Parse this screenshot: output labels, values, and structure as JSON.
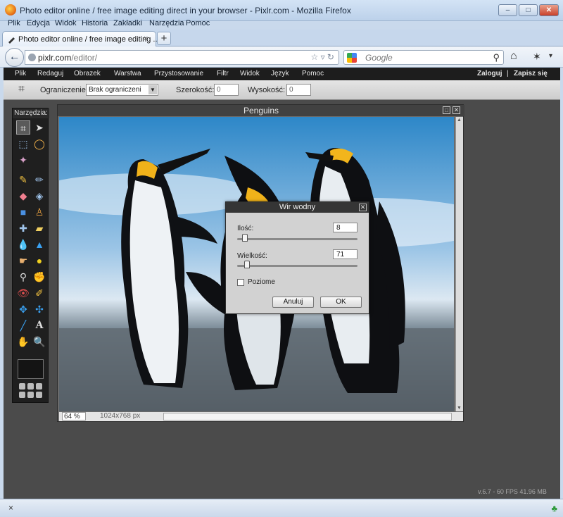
{
  "browser": {
    "window_title": "Photo editor online / free image editing direct in your browser - Pixlr.com - Mozilla Firefox",
    "menu": [
      "Plik",
      "Edycja",
      "Widok",
      "Historia",
      "Zakładki",
      "Narzędzia",
      "Pomoc"
    ],
    "tab_label": "Photo editor online / free image editing ...",
    "tab_close": "×",
    "new_tab": "+",
    "url_host": "pixlr.com",
    "url_path": "/editor/",
    "search_placeholder": "Google",
    "window_buttons": {
      "minimize": "–",
      "maximize": "□",
      "close": "✕"
    },
    "status_close": "×"
  },
  "pixlr": {
    "menu": [
      "Plik",
      "Redaguj",
      "Obrazek",
      "Warstwa",
      "Przystosowanie",
      "Filtr",
      "Widok",
      "Język",
      "Pomoc"
    ],
    "login": "Zaloguj",
    "separator": "|",
    "register": "Zapisz się",
    "crop_bar": {
      "constraint_label": "Ograniczenie:",
      "constraint_value": "Brak ograniczeni",
      "width_label": "Szerokość:",
      "width_value": "0",
      "height_label": "Wysokość:",
      "height_value": "0"
    },
    "tools_title": "Narzędzia:",
    "document": {
      "title": "Penguins",
      "zoom": "64",
      "zoom_unit": "%",
      "size": "1024x768 px"
    },
    "dialog": {
      "title": "Wir wodny",
      "amount_label": "Ilość:",
      "amount_value": "8",
      "amount_fraction": 0.04,
      "size_label": "Wielkość:",
      "size_value": "71",
      "size_fraction": 0.06,
      "horizontal_label": "Poziome",
      "horizontal_checked": false,
      "cancel": "Anuluj",
      "ok": "OK"
    },
    "fps_text": "v.6.7 - 60 FPS 41.96 MB"
  }
}
